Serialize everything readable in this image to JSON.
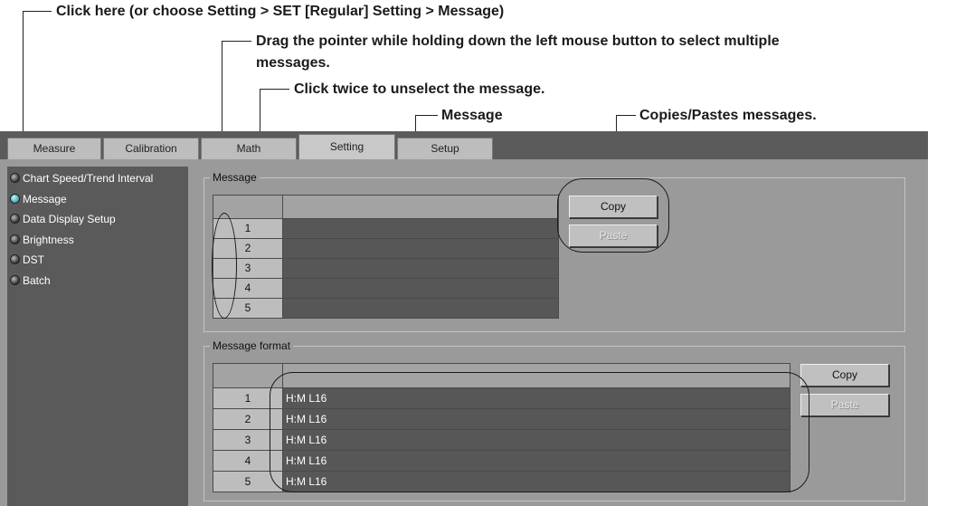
{
  "callouts": {
    "click_here": "Click here (or choose Setting > SET [Regular] Setting > Message)",
    "drag_line1": "Drag the pointer while holding down the left mouse button to select multiple",
    "drag_line2": "messages.",
    "click_twice": "Click twice to unselect the message.",
    "message": "Message",
    "copies": "Copies/Pastes messages."
  },
  "tabs": [
    "Measure",
    "Calibration",
    "Math",
    "Setting",
    "Setup"
  ],
  "active_tab": "Setting",
  "sidebar": {
    "items": [
      {
        "label": "Chart Speed/Trend Interval",
        "selected": false
      },
      {
        "label": "Message",
        "selected": true
      },
      {
        "label": "Data Display Setup",
        "selected": false
      },
      {
        "label": "Brightness",
        "selected": false
      },
      {
        "label": "DST",
        "selected": false
      },
      {
        "label": "Batch",
        "selected": false
      }
    ]
  },
  "message_group": {
    "title": "Message",
    "rows": [
      {
        "num": "1",
        "value": ""
      },
      {
        "num": "2",
        "value": ""
      },
      {
        "num": "3",
        "value": ""
      },
      {
        "num": "4",
        "value": ""
      },
      {
        "num": "5",
        "value": ""
      }
    ],
    "copy_label": "Copy",
    "paste_label": "Paste"
  },
  "format_group": {
    "title": "Message format",
    "rows": [
      {
        "num": "1",
        "value": "H:M L16"
      },
      {
        "num": "2",
        "value": "H:M L16"
      },
      {
        "num": "3",
        "value": "H:M L16"
      },
      {
        "num": "4",
        "value": "H:M L16"
      },
      {
        "num": "5",
        "value": "H:M L16"
      }
    ],
    "copy_label": "Copy",
    "paste_label": "Paste"
  },
  "colors": {
    "panel": "#9a9a9a",
    "tabbar": "#5b5b5b",
    "sidebar": "#5a5a5a",
    "cell": "#575757",
    "selected_dot": "#3aa7b8"
  }
}
